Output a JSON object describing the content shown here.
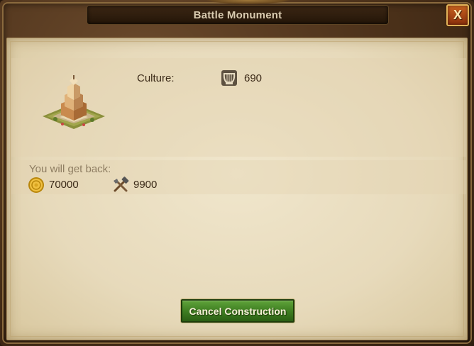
{
  "window": {
    "title": "Battle Monument",
    "close_label": "X"
  },
  "building": {
    "icon": "battle-monument-building"
  },
  "stats": {
    "culture_label": "Culture:",
    "culture_icon": "lyre-icon",
    "culture_value": "690"
  },
  "refund": {
    "label": "You will get back:",
    "coins_icon": "coin-icon",
    "coins_value": "70000",
    "supplies_icon": "hammer-tools-icon",
    "supplies_value": "9900"
  },
  "actions": {
    "cancel_label": "Cancel Construction"
  },
  "colors": {
    "title_text": "#d9cbb0",
    "parchment": "#ece1c5",
    "close_button": "#b3501a",
    "cancel_button": "#3f7f22"
  }
}
